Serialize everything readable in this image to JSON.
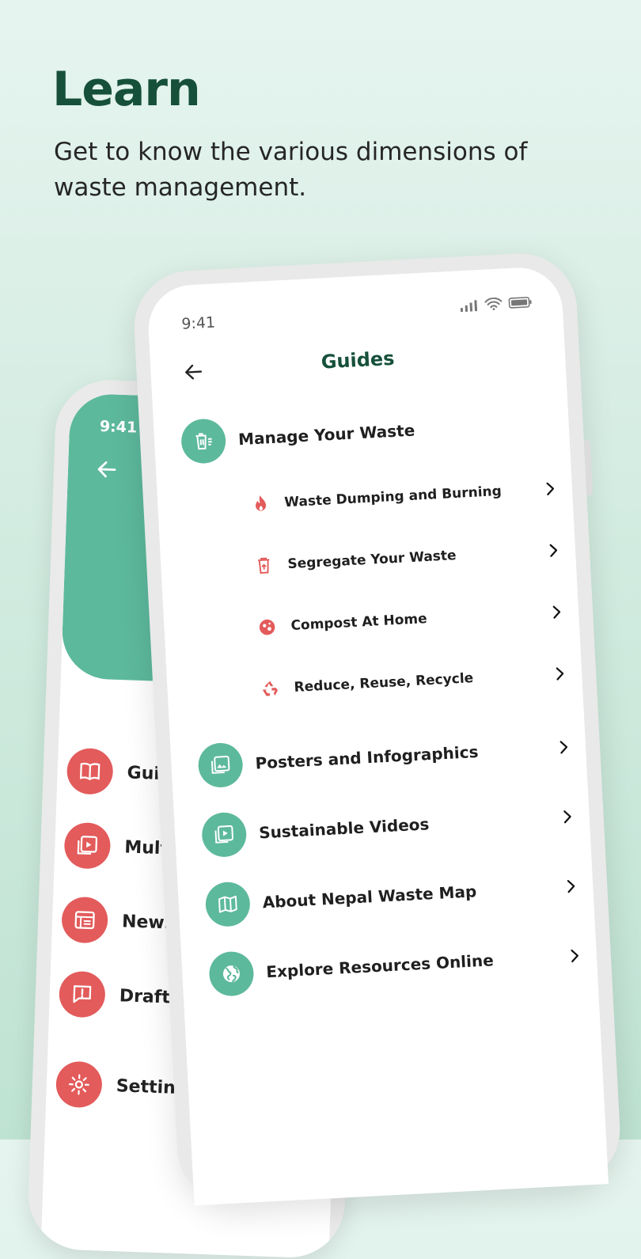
{
  "hero": {
    "title": "Learn",
    "subtitle": "Get to know the various dimensions of waste management."
  },
  "back_phone": {
    "time": "9:41",
    "menu": [
      {
        "label": "Guides",
        "icon": "book-icon"
      },
      {
        "label": "Multimedia",
        "icon": "video-library-icon"
      },
      {
        "label": "News & Events",
        "icon": "newspaper-icon"
      },
      {
        "label": "Draft Feedback",
        "icon": "feedback-icon"
      },
      {
        "label": "Settings",
        "icon": "gear-icon"
      }
    ]
  },
  "front_phone": {
    "time": "9:41",
    "title": "Guides",
    "manage": {
      "label": "Manage Your Waste"
    },
    "sub_items": [
      {
        "label": "Waste Dumping and Burning",
        "icon": "fire-icon"
      },
      {
        "label": "Segregate Your Waste",
        "icon": "bin-icon"
      },
      {
        "label": "Compost At Home",
        "icon": "compost-icon"
      },
      {
        "label": "Reduce, Reuse, Recycle",
        "icon": "recycle-icon"
      }
    ],
    "items": [
      {
        "label": "Posters and Infographics",
        "icon": "image-library-icon"
      },
      {
        "label": "Sustainable Videos",
        "icon": "video-library-icon"
      },
      {
        "label": "About Nepal Waste Map",
        "icon": "map-icon"
      },
      {
        "label": "Explore Resources Online",
        "icon": "globe-icon"
      }
    ]
  },
  "colors": {
    "accent_green": "#5db99c",
    "title_green": "#16503a",
    "accent_red": "#e35b5b"
  }
}
